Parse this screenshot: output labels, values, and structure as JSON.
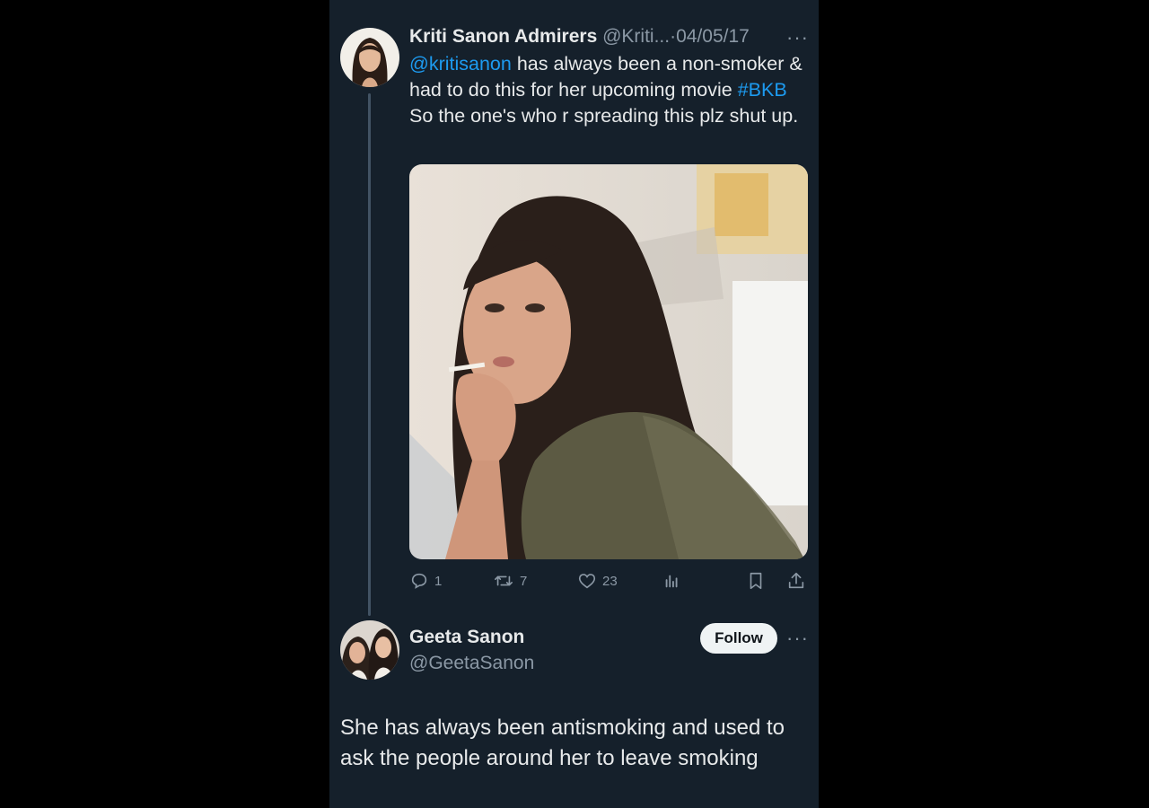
{
  "tweet": {
    "author_name": "Kriti Sanon Admirers",
    "handle": "@Kriti...",
    "separator": "·",
    "date": "04/05/17",
    "more_label": "···",
    "mention": "@kritisanon",
    "text_part1": " has always been a non-smoker & had to do this for her upcoming movie ",
    "hashtag": "#BKB",
    "text_part2": " So the one's who r spreading this plz shut up.",
    "stats": {
      "replies": "1",
      "retweets": "7",
      "likes": "23"
    }
  },
  "reply": {
    "author_name": "Geeta Sanon",
    "handle": "@GeetaSanon",
    "follow_label": "Follow",
    "more_label": "···",
    "text": "She has always been antismoking  and  used to ask the people around her to leave smoking"
  },
  "colors": {
    "background": "#15202b",
    "link": "#1d9bf0",
    "muted": "#8b98a5",
    "text": "#e7e9ea"
  },
  "icons": [
    "reply-icon",
    "retweet-icon",
    "like-icon",
    "views-icon",
    "bookmark-icon",
    "share-icon",
    "more-icon"
  ]
}
